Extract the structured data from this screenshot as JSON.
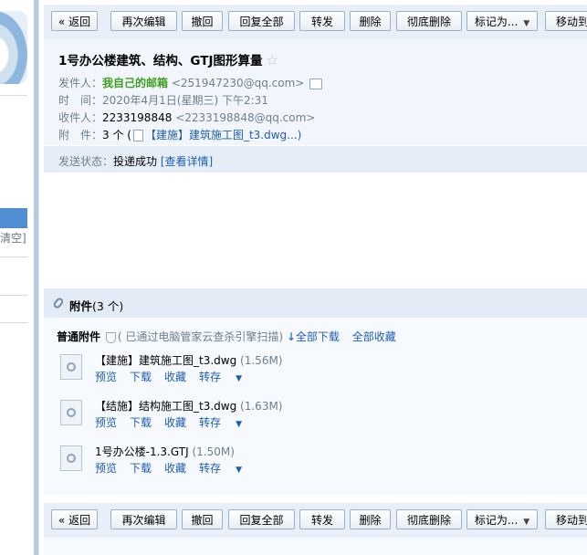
{
  "sidebar": {
    "clear_label": "清空]"
  },
  "toolbar": {
    "back": "« 返回",
    "reedit": "再次编辑",
    "recall": "撤回",
    "reply_all": "回复全部",
    "forward": "转发",
    "delete": "删除",
    "delete_forever": "彻底删除",
    "mark_as": "标记为...",
    "move_to": "移动到"
  },
  "mail": {
    "subject": "1号办公楼建筑、结构、GTJ图形算量",
    "star": "☆",
    "sender_label": "发件人：",
    "sender_name": "我自己的邮箱",
    "sender_email": "<251947230@qq.com>",
    "time_label": "时　间：",
    "time_value": "2020年4月1日(星期三) 下午2:31",
    "recipient_label": "收件人：",
    "recipient_name": "2233198848",
    "recipient_email": "<2233198848@qq.com>",
    "attach_label": "附　件：",
    "attach_count": "3 个 (",
    "attach_preview": "【建施】建筑施工图_t3.dwg...)",
    "status_label": "发送状态：",
    "status_value": "投递成功",
    "status_detail": "[查看详情]"
  },
  "attachments": {
    "title": "附件",
    "count": "(3 个)",
    "normal_label": "普通附件",
    "scan_text": "( 已通过电脑管家云查杀引擎扫描)",
    "download_all": "全部下载",
    "collect_all": "全部收藏",
    "actions": {
      "preview": "预览",
      "download": "下载",
      "collect": "收藏",
      "save_to": "转存"
    },
    "files": [
      {
        "name": "【建施】建筑施工图_t3.dwg",
        "size": "(1.56M)"
      },
      {
        "name": "【结施】结构施工图_t3.dwg",
        "size": "(1.63M)"
      },
      {
        "name": "1号办公楼-1.3.GTJ",
        "size": "(1.50M)"
      }
    ]
  }
}
